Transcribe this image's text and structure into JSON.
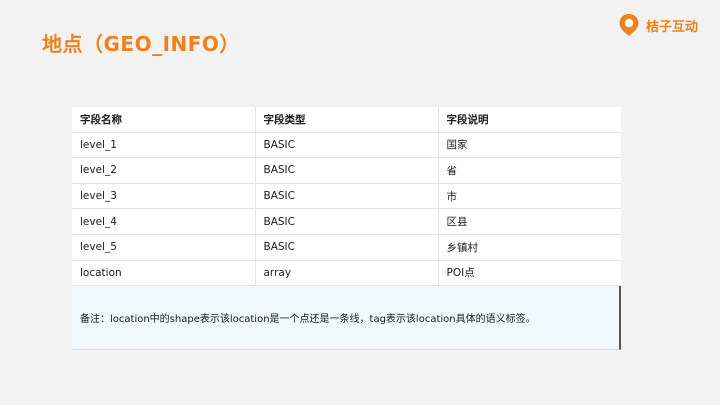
{
  "slide": {
    "title": "地点（GEO_INFO）"
  },
  "brand": {
    "name": "桔子互动",
    "color": "#f08119"
  },
  "table": {
    "headers": [
      "字段名称",
      "字段类型",
      "字段说明"
    ],
    "rows": [
      [
        "level_1",
        "BASIC",
        "国家"
      ],
      [
        "level_2",
        "BASIC",
        "省"
      ],
      [
        "level_3",
        "BASIC",
        "市"
      ],
      [
        "level_4",
        "BASIC",
        "区县"
      ],
      [
        "level_5",
        "BASIC",
        "乡镇村"
      ],
      [
        "location",
        "array",
        "POI点"
      ]
    ]
  },
  "note": {
    "text": "备注：location中的shape表示该location是一个点还是一条线，tag表示该location具体的语义标签。"
  }
}
